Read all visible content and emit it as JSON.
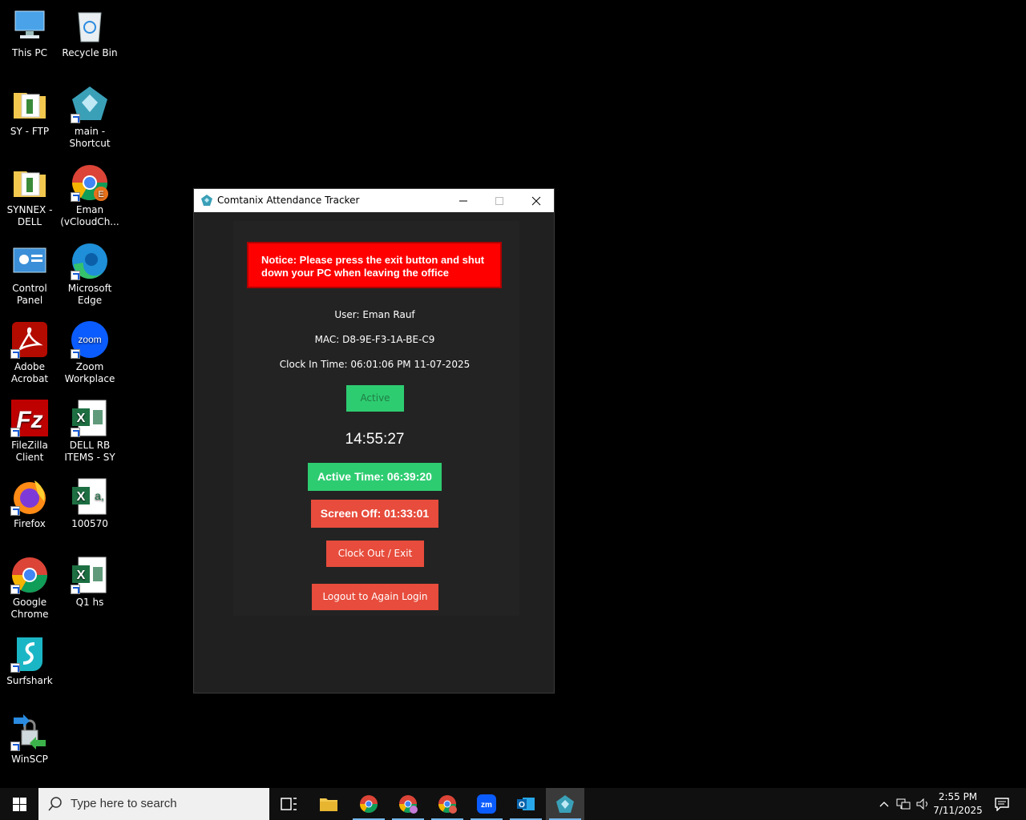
{
  "desktop": {
    "icons": [
      {
        "label": "This PC",
        "icon": "computer-icon"
      },
      {
        "label": "Recycle Bin",
        "icon": "recycle-bin-icon"
      },
      {
        "label": "SY - FTP",
        "icon": "folder-icon"
      },
      {
        "label": "main - Shortcut",
        "icon": "app-diamond-icon"
      },
      {
        "label": "SYNNEX - DELL",
        "icon": "folder-icon"
      },
      {
        "label": "Eman (vCloudCh...",
        "icon": "chrome-profile-icon"
      },
      {
        "label": "Control Panel",
        "icon": "control-panel-icon"
      },
      {
        "label": "Microsoft Edge",
        "icon": "edge-icon"
      },
      {
        "label": "Adobe Acrobat",
        "icon": "acrobat-icon"
      },
      {
        "label": "Zoom Workplace",
        "icon": "zoom-icon"
      },
      {
        "label": "FileZilla Client",
        "icon": "filezilla-icon"
      },
      {
        "label": "DELL RB ITEMS - SY",
        "icon": "excel-icon"
      },
      {
        "label": "Firefox",
        "icon": "firefox-icon"
      },
      {
        "label": "100570",
        "icon": "excel-icon"
      },
      {
        "label": "Google Chrome",
        "icon": "chrome-icon"
      },
      {
        "label": "Q1 hs",
        "icon": "excel-icon"
      },
      {
        "label": "Surfshark",
        "icon": "surfshark-icon"
      },
      {
        "label": "WinSCP",
        "icon": "winscp-icon"
      }
    ]
  },
  "window": {
    "title": "Comtanix Attendance Tracker",
    "notice": "Notice: Please press the exit button and shut down your PC when leaving the office",
    "user": "User: Eman Rauf",
    "mac": "MAC: D8-9E-F3-1A-BE-C9",
    "clock_in": "Clock In Time: 06:01:06 PM 11-07-2025",
    "status": "Active",
    "current_time": "14:55:27",
    "active_time": "Active Time: 06:39:20",
    "screen_off": "Screen Off: 01:33:01",
    "clock_out_label": "Clock Out / Exit",
    "logout_label": "Logout to Again Login"
  },
  "taskbar": {
    "search_placeholder": "Type here to search",
    "apps": [
      "task-view-icon",
      "file-explorer-icon",
      "chrome-icon",
      "chrome-profile-icon",
      "chrome-profile-icon",
      "zoom-icon",
      "outlook-icon",
      "attendance-tracker-icon"
    ],
    "time": "2:55 PM",
    "date": "7/11/2025"
  },
  "colors": {
    "notice_bg": "#ff0000",
    "active_green": "#2ecc71",
    "danger_red": "#e74c3c",
    "window_bg": "#202020"
  }
}
